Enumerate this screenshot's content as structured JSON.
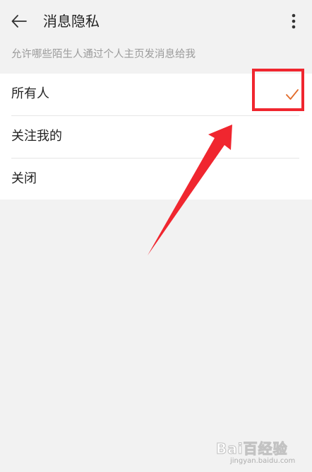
{
  "header": {
    "back_icon": "back-arrow-icon",
    "title": "消息隐私",
    "more_icon": "more-vertical-icon"
  },
  "subtitle": "允许哪些陌生人通过个人主页发消息给我",
  "options": [
    {
      "label": "所有人",
      "selected": true
    },
    {
      "label": "关注我的",
      "selected": false
    },
    {
      "label": "关闭",
      "selected": false
    }
  ],
  "colors": {
    "accent": "#e26b2a",
    "annotation": "#f0262f",
    "background": "#f2f2f2"
  },
  "watermark": {
    "text": "Bai百经验",
    "url": "jingyan.baidu.com"
  }
}
